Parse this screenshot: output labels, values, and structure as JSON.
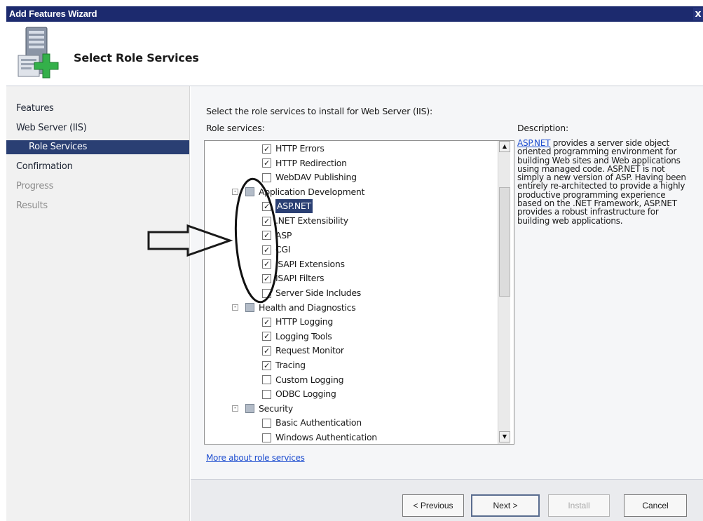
{
  "window": {
    "title": "Add Features Wizard",
    "close_glyph": "x"
  },
  "header": {
    "title": "Select Role Services",
    "icon": "server-add-icon"
  },
  "nav": {
    "items": [
      {
        "label": "Features",
        "state": "done"
      },
      {
        "label": "Web Server (IIS)",
        "state": "done"
      },
      {
        "label": "Role Services",
        "state": "selected"
      },
      {
        "label": "Confirmation",
        "state": "done"
      },
      {
        "label": "Progress",
        "state": "future"
      },
      {
        "label": "Results",
        "state": "future"
      }
    ]
  },
  "content": {
    "intro": "Select the role services to install for Web Server (IIS):",
    "role_services_label": "Role services:",
    "description_label": "Description:",
    "description_link": "ASP.NET",
    "description_text": " provides a server side object oriented programming environment for building Web sites and Web applications using managed code. ASP.NET is not simply a new version of ASP. Having been entirely re-architected to provide a highly productive programming experience based on the .NET Framework, ASP.NET provides a robust infrastructure for building web applications.",
    "more_link": "More about role services"
  },
  "tree": [
    {
      "label": "HTTP Errors",
      "level": 2,
      "checked": true
    },
    {
      "label": "HTTP Redirection",
      "level": 2,
      "checked": true
    },
    {
      "label": "WebDAV Publishing",
      "level": 2,
      "checked": false
    },
    {
      "label": "Application Development",
      "level": 1,
      "checked": "partial",
      "expander": "-"
    },
    {
      "label": "ASP.NET",
      "level": 2,
      "checked": true,
      "selected": true
    },
    {
      "label": ".NET Extensibility",
      "level": 2,
      "checked": true
    },
    {
      "label": "ASP",
      "level": 2,
      "checked": true
    },
    {
      "label": "CGI",
      "level": 2,
      "checked": true
    },
    {
      "label": "ISAPI Extensions",
      "level": 2,
      "checked": true
    },
    {
      "label": "ISAPI Filters",
      "level": 2,
      "checked": true
    },
    {
      "label": "Server Side Includes",
      "level": 2,
      "checked": false
    },
    {
      "label": "Health and Diagnostics",
      "level": 1,
      "checked": "partial",
      "expander": "-"
    },
    {
      "label": "HTTP Logging",
      "level": 2,
      "checked": true
    },
    {
      "label": "Logging Tools",
      "level": 2,
      "checked": true
    },
    {
      "label": "Request Monitor",
      "level": 2,
      "checked": true
    },
    {
      "label": "Tracing",
      "level": 2,
      "checked": true
    },
    {
      "label": "Custom Logging",
      "level": 2,
      "checked": false
    },
    {
      "label": "ODBC Logging",
      "level": 2,
      "checked": false
    },
    {
      "label": "Security",
      "level": 1,
      "checked": "partial",
      "expander": "-"
    },
    {
      "label": "Basic Authentication",
      "level": 2,
      "checked": false
    },
    {
      "label": "Windows Authentication",
      "level": 2,
      "checked": false
    }
  ],
  "buttons": {
    "previous": "< Previous",
    "next": "Next >",
    "install": "Install",
    "cancel": "Cancel"
  },
  "glyphs": {
    "check": "✓",
    "scroll_up": "▲",
    "scroll_down": "▼"
  },
  "colors": {
    "title_bar": "#1c2a6e",
    "selection": "#2a3f73",
    "link": "#1f4fd0"
  }
}
